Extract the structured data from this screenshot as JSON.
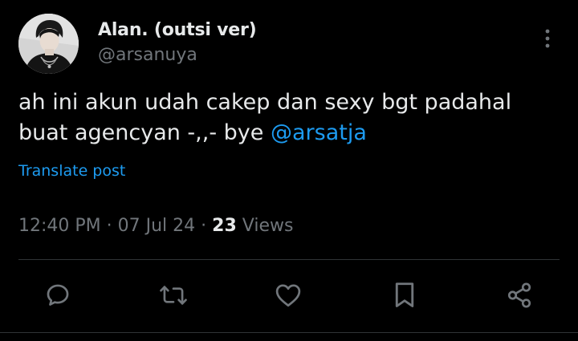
{
  "author": {
    "display_name": "Alan. (outsi ver)",
    "handle": "@arsanuya"
  },
  "tweet": {
    "text_before": "ah ini akun udah cakep dan sexy bgt padahal buat agencyan -,,- bye ",
    "mention": "@arsatja"
  },
  "translate_label": "Translate post",
  "meta": {
    "time": "12:40 PM",
    "separator1": " · ",
    "date": "07 Jul 24",
    "separator2": " · ",
    "views_count": "23",
    "views_label": " Views"
  },
  "actions": [
    {
      "icon": "reply-icon"
    },
    {
      "icon": "retweet-icon"
    },
    {
      "icon": "like-icon"
    },
    {
      "icon": "bookmark-icon"
    },
    {
      "icon": "share-icon"
    }
  ],
  "colors": {
    "background": "#000000",
    "text_primary": "#e7e9ea",
    "text_secondary": "#71767b",
    "accent": "#1d9bf0",
    "divider": "#2f3336"
  }
}
